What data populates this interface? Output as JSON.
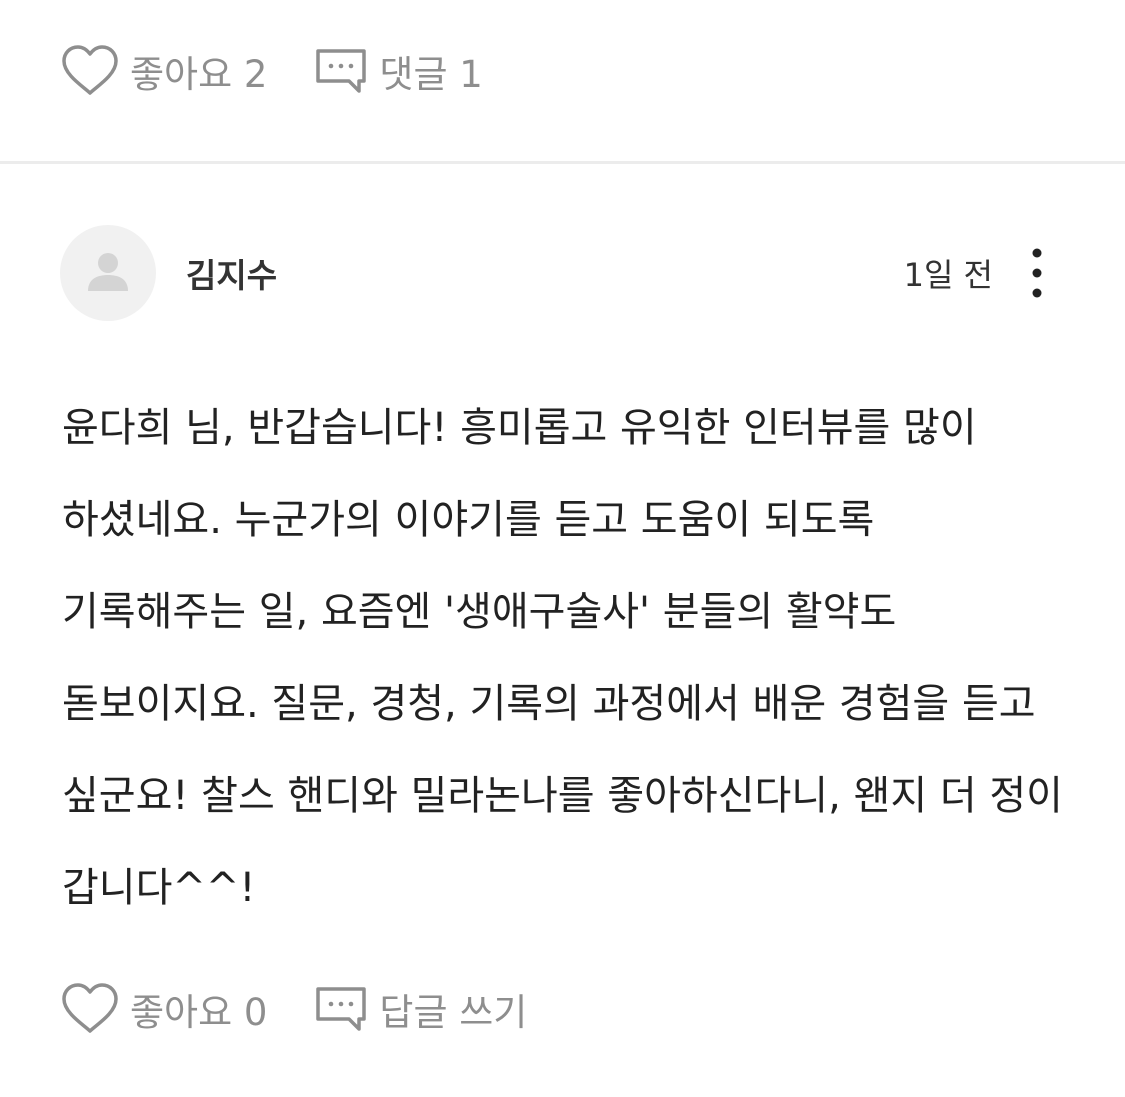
{
  "post_actions": {
    "like_label": "좋아요 2",
    "comment_label": "댓글 1"
  },
  "comment": {
    "author": "김지수",
    "time": "1일 전",
    "text": "윤다희 님, 반갑습니다! 흥미롭고 유익한 인터뷰를 많이 하셨네요. 누군가의 이야기를 듣고 도움이 되도록 기록해주는 일, 요즘엔 '생애구술사' 분들의 활약도 돋보이지요. 질문, 경청, 기록의 과정에서 배운 경험을 듣고 싶군요! 찰스 핸디와 밀라논나를 좋아하신다니, 왠지 더 정이 갑니다^^!",
    "like_label": "좋아요 0",
    "reply_label": "답글 쓰기"
  },
  "icons": {
    "like": "heart-outline-icon",
    "comment": "speech-bubble-ellipsis-icon",
    "avatar": "default-user-icon",
    "more": "vertical-ellipsis-icon"
  },
  "colors": {
    "icon_gray": "#8e8e8e",
    "text_dark": "#222222",
    "avatar_bg": "#f1f1f1",
    "avatar_figure": "#d4d4d4",
    "divider": "#ececec"
  }
}
